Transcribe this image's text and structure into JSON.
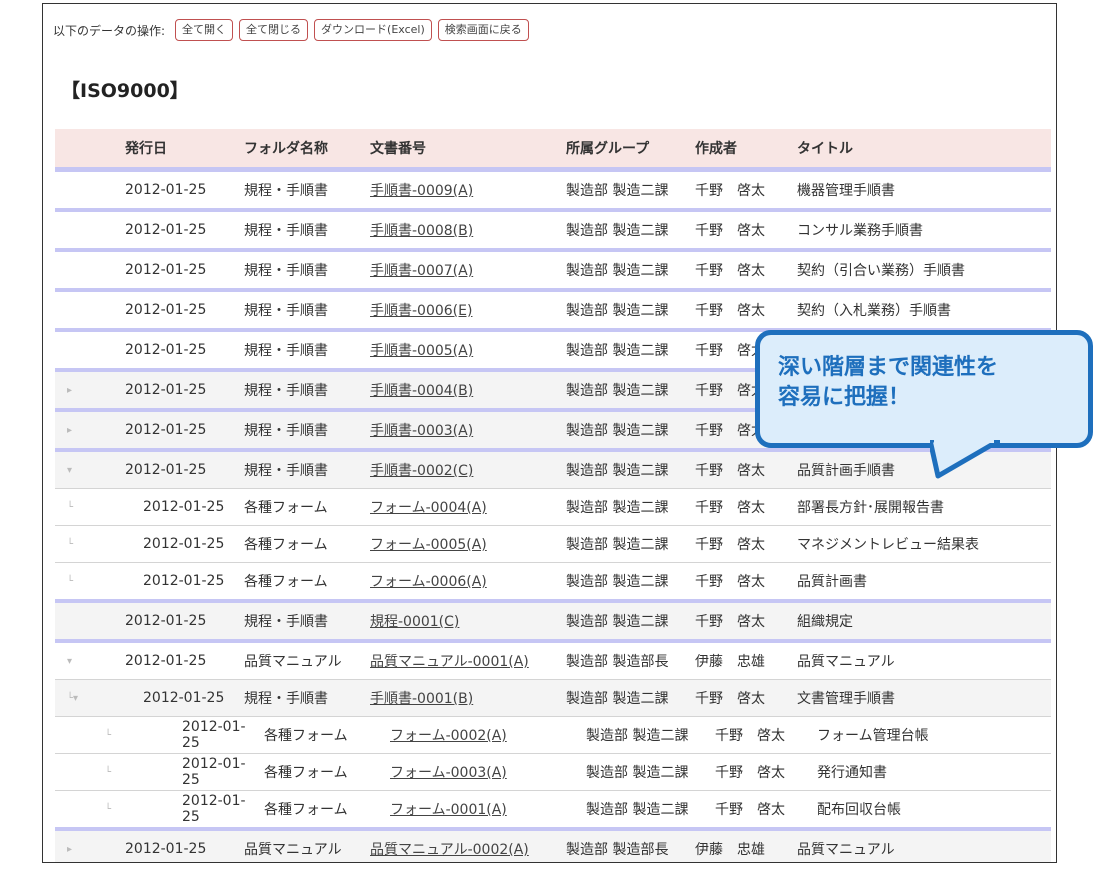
{
  "toolbar": {
    "label": "以下のデータの操作:",
    "buttons": [
      "全て開く",
      "全て閉じる",
      "ダウンロード(Excel)",
      "検索画面に戻る"
    ]
  },
  "section_title": "【ISO9000】",
  "headers": [
    "発行日",
    "フォルダ名称",
    "文書番号",
    "所属グループ",
    "作成者",
    "タイトル"
  ],
  "rows": [
    {
      "toggle": "",
      "date": "2012-01-25",
      "folder": "規程・手順書",
      "doc": "手順書-0009(A)",
      "group": "製造部 製造二課",
      "author": "千野　啓太",
      "title": "機器管理手順書"
    },
    {
      "toggle": "",
      "date": "2012-01-25",
      "folder": "規程・手順書",
      "doc": "手順書-0008(B)",
      "group": "製造部 製造二課",
      "author": "千野　啓太",
      "title": "コンサル業務手順書"
    },
    {
      "toggle": "",
      "date": "2012-01-25",
      "folder": "規程・手順書",
      "doc": "手順書-0007(A)",
      "group": "製造部 製造二課",
      "author": "千野　啓太",
      "title": "契約（引合い業務）手順書"
    },
    {
      "toggle": "",
      "date": "2012-01-25",
      "folder": "規程・手順書",
      "doc": "手順書-0006(E)",
      "group": "製造部 製造二課",
      "author": "千野　啓太",
      "title": "契約（入札業務）手順書"
    },
    {
      "toggle": "",
      "date": "2012-01-25",
      "folder": "規程・手順書",
      "doc": "手順書-0005(A)",
      "group": "製造部 製造二課",
      "author": "千野　啓太",
      "title": ""
    },
    {
      "toggle": "▸",
      "date": "2012-01-25",
      "folder": "規程・手順書",
      "doc": "手順書-0004(B)",
      "group": "製造部 製造二課",
      "author": "千野　啓太",
      "title": ""
    },
    {
      "toggle": "▸",
      "date": "2012-01-25",
      "folder": "規程・手順書",
      "doc": "手順書-0003(A)",
      "group": "製造部 製造二課",
      "author": "千野　啓太",
      "title": ""
    },
    {
      "toggle": "▾",
      "date": "2012-01-25",
      "folder": "規程・手順書",
      "doc": "手順書-0002(C)",
      "group": "製造部 製造二課",
      "author": "千野　啓太",
      "title": "品質計画手順書"
    },
    {
      "toggle": "└",
      "date": "2012-01-25",
      "folder": "各種フォーム",
      "doc": "フォーム-0004(A)",
      "group": "製造部 製造二課",
      "author": "千野　啓太",
      "title": "部署長方針･展開報告書"
    },
    {
      "toggle": "└",
      "date": "2012-01-25",
      "folder": "各種フォーム",
      "doc": "フォーム-0005(A)",
      "group": "製造部 製造二課",
      "author": "千野　啓太",
      "title": "マネジメントレビュー結果表"
    },
    {
      "toggle": "└",
      "date": "2012-01-25",
      "folder": "各種フォーム",
      "doc": "フォーム-0006(A)",
      "group": "製造部 製造二課",
      "author": "千野　啓太",
      "title": "品質計画書"
    },
    {
      "toggle": "",
      "date": "2012-01-25",
      "folder": "規程・手順書",
      "doc": "規程-0001(C)",
      "group": "製造部 製造二課",
      "author": "千野　啓太",
      "title": "組織規定"
    },
    {
      "toggle": "▾",
      "date": "2012-01-25",
      "folder": "品質マニュアル",
      "doc": "品質マニュアル-0001(A)",
      "group": "製造部 製造部長",
      "author": "伊藤　忠雄",
      "title": "品質マニュアル"
    },
    {
      "toggle": "└▾",
      "date": "2012-01-25",
      "folder": "規程・手順書",
      "doc": "手順書-0001(B)",
      "group": "製造部 製造二課",
      "author": "千野　啓太",
      "title": "文書管理手順書"
    },
    {
      "toggle": "└",
      "date": "2012-01-25",
      "folder": "各種フォーム",
      "doc": "フォーム-0002(A)",
      "group": "製造部 製造二課",
      "author": "千野　啓太",
      "title": "フォーム管理台帳"
    },
    {
      "toggle": "└",
      "date": "2012-01-25",
      "folder": "各種フォーム",
      "doc": "フォーム-0003(A)",
      "group": "製造部 製造二課",
      "author": "千野　啓太",
      "title": "発行通知書"
    },
    {
      "toggle": "└",
      "date": "2012-01-25",
      "folder": "各種フォーム",
      "doc": "フォーム-0001(A)",
      "group": "製造部 製造二課",
      "author": "千野　啓太",
      "title": "配布回収台帳"
    },
    {
      "toggle": "▸",
      "date": "2012-01-25",
      "folder": "品質マニュアル",
      "doc": "品質マニュアル-0002(A)",
      "group": "製造部 製造部長",
      "author": "伊藤　忠雄",
      "title": "品質マニュアル"
    }
  ],
  "callout": {
    "line1": "深い階層まで関連性を",
    "line2": "容易に把握！"
  },
  "colors": {
    "header_bg": "#f8e6e4",
    "row_separator": "#c6c6f4",
    "callout_border": "#1e6fbd",
    "callout_bg": "#dcedfb"
  }
}
